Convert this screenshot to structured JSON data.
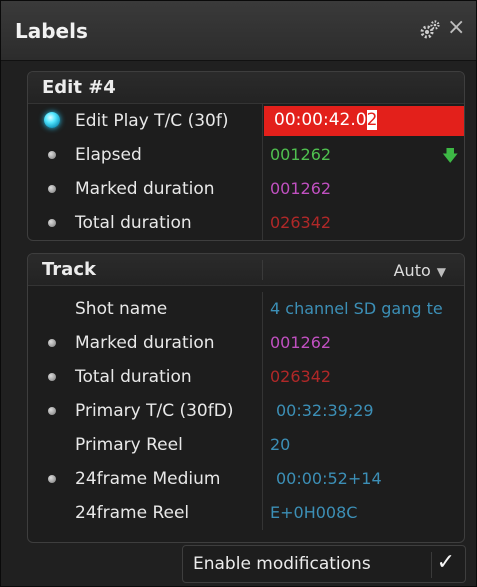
{
  "window": {
    "title": "Labels",
    "icons": {
      "settings": "gear-icon",
      "close": "close-icon"
    },
    "close_glyph": "×"
  },
  "edit_panel": {
    "title": "Edit #4",
    "rows": [
      {
        "label": "Edit Play T/C (30f)",
        "value_main": "00:00:42.0",
        "value_caret": "2",
        "value_color": "#ffffff",
        "active": true
      },
      {
        "label": "Elapsed",
        "value": "001262",
        "value_color": "#4fc04f",
        "indicator": "down-arrow-icon"
      },
      {
        "label": "Marked duration",
        "value": "001262",
        "value_color": "#c050c0"
      },
      {
        "label": "Total duration",
        "value": "026342",
        "value_color": "#b02828"
      }
    ]
  },
  "track_panel": {
    "title": "Track",
    "mode": "Auto",
    "rows": [
      {
        "label": "Shot name",
        "value": "4 channel SD gang te",
        "dot": false
      },
      {
        "label": "Marked duration",
        "value": "001262",
        "dot": true
      },
      {
        "label": "Total duration",
        "value": "026342",
        "dot": true
      },
      {
        "label": "Primary T/C (30fD)",
        "value": "00:32:39;29",
        "dot": true
      },
      {
        "label": "Primary Reel",
        "value": "20",
        "dot": false
      },
      {
        "label": "24frame Medium",
        "value": "00:00:52+14",
        "dot": true
      },
      {
        "label": "24frame Reel",
        "value": "E+0H008C",
        "dot": false
      }
    ]
  },
  "footer": {
    "enable_label": "Enable modifications",
    "checked": true,
    "check_glyph": "✓"
  },
  "colors": {
    "accent_red": "#e3201b",
    "active_dot": "#26c8f2",
    "green": "#4fc04f",
    "magenta": "#c050c0",
    "red": "#b02828",
    "blue": "#3c8fb6"
  }
}
